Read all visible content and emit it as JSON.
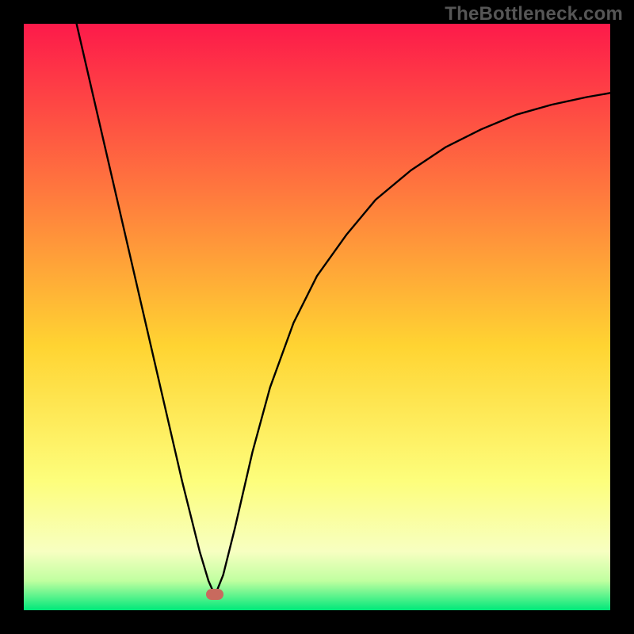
{
  "watermark": "TheBottleneck.com",
  "gradient_colors": {
    "top": "#fd1a4a",
    "mid_upper": "#ff763e",
    "mid": "#ffd432",
    "mid_lower": "#fdfe7c",
    "low": "#f7ffc1",
    "very_low": "#c0ffa0",
    "bottom": "#00e87a"
  },
  "marker": {
    "x_pct": 32.6,
    "y_pct": 97.3
  },
  "chart_data": {
    "type": "line",
    "title": "",
    "xlabel": "",
    "ylabel": "",
    "xlim": [
      0,
      100
    ],
    "ylim": [
      0,
      100
    ],
    "series": [
      {
        "name": "curve",
        "x": [
          9,
          12,
          15,
          18,
          21,
          24,
          27,
          30,
          31.5,
          32.6,
          34,
          36,
          39,
          42,
          46,
          50,
          55,
          60,
          66,
          72,
          78,
          84,
          90,
          96,
          100
        ],
        "y": [
          100,
          87,
          74,
          61,
          48,
          35,
          22,
          10,
          5,
          2.5,
          6,
          14,
          27,
          38,
          49,
          57,
          64,
          70,
          75,
          79,
          82,
          84.5,
          86.2,
          87.5,
          88.2
        ]
      }
    ],
    "marker_point": {
      "x": 32.6,
      "y": 2.7
    }
  }
}
